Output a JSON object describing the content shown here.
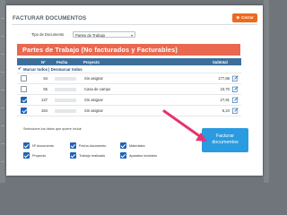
{
  "modal": {
    "title": "FACTURAR DOCUMENTOS",
    "close_label": "Cerrar"
  },
  "filter": {
    "label": "Tipo de Documento",
    "selected": "Partes de Trabajo"
  },
  "banner": "Partes de Trabajo (No facturados y Facturables)",
  "table": {
    "columns": [
      "Nº",
      "Fecha",
      "Proyecto",
      "Subtotal"
    ],
    "marcar_label": "Marcar todos | Desmarcar todos",
    "rows": [
      {
        "checked": false,
        "num": "54",
        "project": "Sin asignar",
        "subtotal": "177,86"
      },
      {
        "checked": false,
        "num": "55",
        "project": "Casa de campo",
        "subtotal": "23,70"
      },
      {
        "checked": true,
        "num": "147",
        "project": "Sin asignar",
        "subtotal": "27,91"
      },
      {
        "checked": true,
        "num": "164",
        "project": "Sin asignar",
        "subtotal": "5,24"
      }
    ]
  },
  "options": {
    "hint": "Seleccione los datos que quiere incluir",
    "items": [
      "Nº documento",
      "Fecha documento",
      "Materiales",
      "Proyecto",
      "Trabajo realizado",
      "Aparatos incluidos"
    ]
  },
  "action": {
    "line1": "Facturar",
    "line2": "documentos"
  },
  "colors": {
    "accent": "#2a9be0",
    "banner": "#e9684e",
    "close": "#ec6a1f",
    "arrow": "#e6336f",
    "checkbox": "#1f63b8"
  }
}
